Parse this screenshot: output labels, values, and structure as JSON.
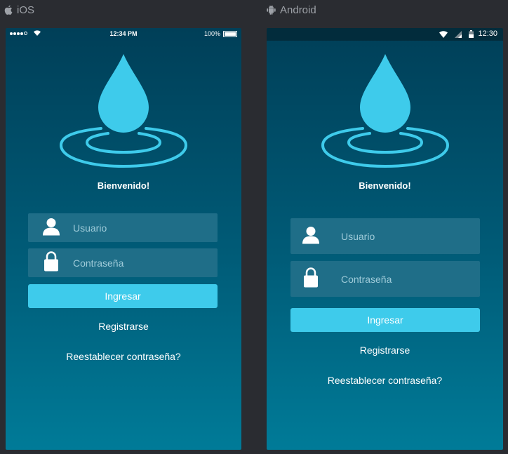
{
  "platforms": {
    "ios": {
      "label": "iOS",
      "icon": "apple-icon"
    },
    "android": {
      "label": "Android",
      "icon": "android-icon"
    }
  },
  "ios_screen": {
    "status_time": "12:34 PM",
    "battery": "100%",
    "welcome": "Bienvenido!",
    "username_placeholder": "Usuario",
    "password_placeholder": "Contraseña",
    "login_button": "Ingresar",
    "register_link": "Registrarse",
    "reset_link": "Reestablecer contraseña?"
  },
  "android_screen": {
    "status_time": "12:30",
    "welcome": "Bienvenido!",
    "username_placeholder": "Usuario",
    "password_placeholder": "Contraseña",
    "login_button": "Ingresar",
    "register_link": "Registrarse",
    "reset_link": "Reestablecer contraseña?"
  },
  "colors": {
    "accent": "#3ecbeb",
    "field_bg": "#1f6e88",
    "gradient_top": "#003f58",
    "gradient_bottom": "#007b98"
  }
}
